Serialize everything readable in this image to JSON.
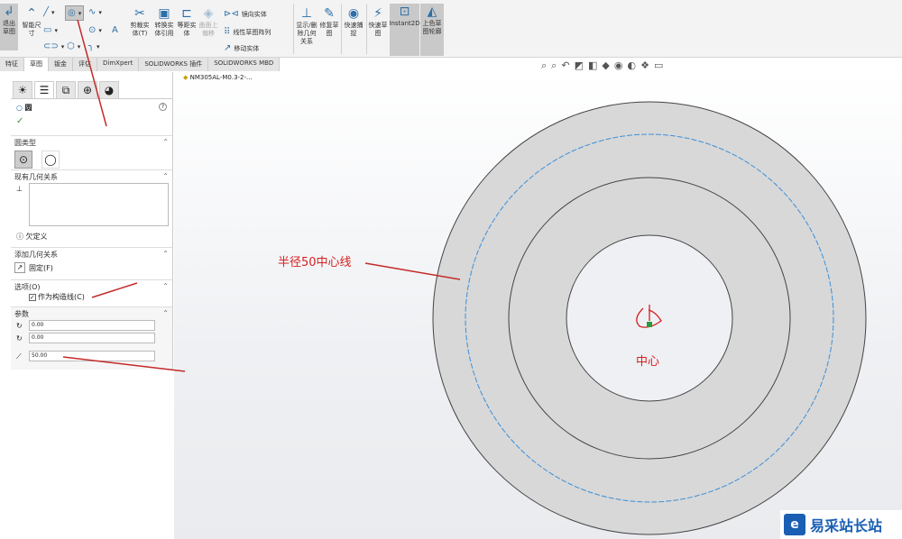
{
  "toolbar": {
    "exit_sketch": "退出草图",
    "smart_dim": "智能尺寸",
    "trim": "剪裁实体(T)",
    "convert": "转换实体引用",
    "offset": "等距实体",
    "surface": "曲面上偏移",
    "mirror": "镜向实体",
    "linear_pattern": "线性草图阵列",
    "move": "移动实体",
    "display_relations": "显示/删除几何关系",
    "repair": "修复草图",
    "quick_snap": "快速捕捉",
    "rapid_sketch": "快速草图",
    "instant2d": "Instant2D",
    "shaded": "上色草图轮廓"
  },
  "tabs": [
    "特征",
    "草图",
    "钣金",
    "评估",
    "DimXpert",
    "SOLIDWORKS 插件",
    "SOLIDWORKS MBD"
  ],
  "active_tab": 1,
  "tree_item": "NM305AL-M0.3-2-...",
  "panel": {
    "title": "圆",
    "help": "?",
    "confirm": "✓",
    "circle_type": "圆类型",
    "existing_relations": "现有几何关系",
    "status": "欠定义",
    "add_relations": "添加几何关系",
    "fixed": "固定(F)",
    "options": "选项(O)",
    "construction": "作为构造线(C)",
    "construction_checked": true,
    "params": "参数",
    "cx": "0.00",
    "cy": "0.00",
    "radius": "50.00"
  },
  "annotations": {
    "centerline": "半径50中心线",
    "center": "中心"
  },
  "watermark": "易采站长站",
  "colors": {
    "arrow": "#c42a2a",
    "construction": "#3b8fd9",
    "ring": "#d8d8d8"
  }
}
